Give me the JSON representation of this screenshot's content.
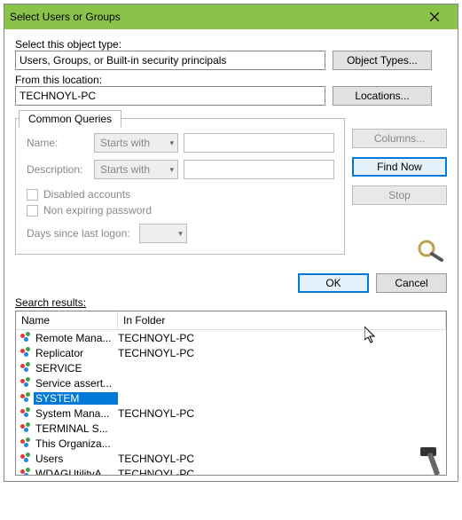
{
  "title": "Select Users or Groups",
  "objectType": {
    "label": "Select this object type:",
    "value": "Users, Groups, or Built-in security principals",
    "button": "Object Types..."
  },
  "location": {
    "label": "From this location:",
    "value": "TECHNOYL-PC",
    "button": "Locations..."
  },
  "queries": {
    "tab": "Common Queries",
    "nameLabel": "Name:",
    "nameOp": "Starts with",
    "descLabel": "Description:",
    "descOp": "Starts with",
    "disabled": "Disabled accounts",
    "nonexp": "Non expiring password",
    "daysLabel": "Days since last logon:"
  },
  "sideButtons": {
    "columns": "Columns...",
    "findNow": "Find Now",
    "stop": "Stop"
  },
  "dialogButtons": {
    "ok": "OK",
    "cancel": "Cancel"
  },
  "search": {
    "label": "Search results:",
    "colName": "Name",
    "colFolder": "In Folder"
  },
  "results": [
    {
      "name": "Remote Mana...",
      "folder": "TECHNOYL-PC",
      "selected": false
    },
    {
      "name": "Replicator",
      "folder": "TECHNOYL-PC",
      "selected": false
    },
    {
      "name": "SERVICE",
      "folder": "",
      "selected": false
    },
    {
      "name": "Service assert...",
      "folder": "",
      "selected": false
    },
    {
      "name": "SYSTEM",
      "folder": "",
      "selected": true
    },
    {
      "name": "System Mana...",
      "folder": "TECHNOYL-PC",
      "selected": false
    },
    {
      "name": "TERMINAL S...",
      "folder": "",
      "selected": false
    },
    {
      "name": "This Organiza...",
      "folder": "",
      "selected": false
    },
    {
      "name": "Users",
      "folder": "TECHNOYL-PC",
      "selected": false
    },
    {
      "name": "WDAGUtilityA...",
      "folder": "TECHNOYL-PC",
      "selected": false
    }
  ]
}
